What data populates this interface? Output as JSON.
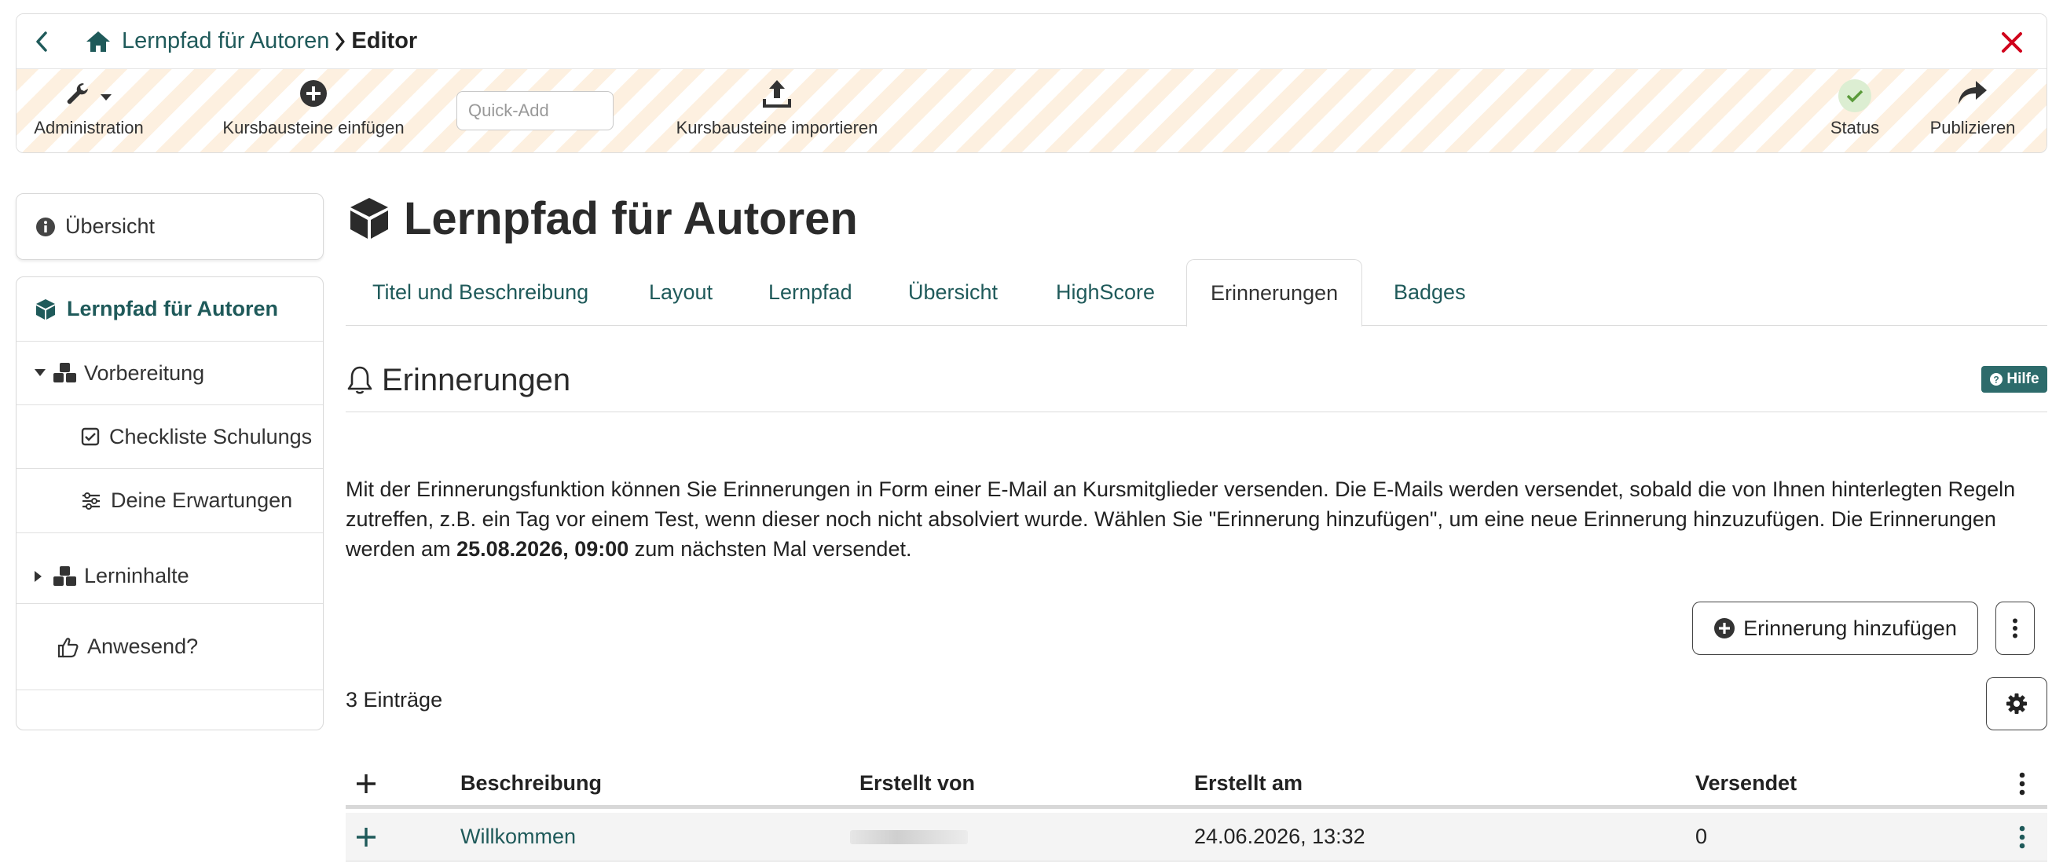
{
  "breadcrumb": {
    "course_link": "Lernpfad für Autoren",
    "current": "Editor"
  },
  "toolbar": {
    "administration": "Administration",
    "insert_nodes": "Kursbausteine einfügen",
    "quick_add_placeholder": "Quick-Add",
    "import_nodes": "Kursbausteine importieren",
    "status": "Status",
    "publish": "Publizieren"
  },
  "sidebar": {
    "overview": "Übersicht",
    "course_root": "Lernpfad für Autoren",
    "items": [
      {
        "label": "Vorbereitung"
      },
      {
        "label": "Checkliste Schulungs"
      },
      {
        "label": "Deine Erwartungen"
      },
      {
        "label": "Lerninhalte"
      },
      {
        "label": "Anwesend?"
      }
    ]
  },
  "page": {
    "title": "Lernpfad für Autoren"
  },
  "tabs": [
    {
      "label": "Titel und Beschreibung"
    },
    {
      "label": "Layout"
    },
    {
      "label": "Lernpfad"
    },
    {
      "label": "Übersicht"
    },
    {
      "label": "HighScore"
    },
    {
      "label": "Erinnerungen"
    },
    {
      "label": "Badges"
    }
  ],
  "reminders": {
    "section_title": "Erinnerungen",
    "help": "Hilfe",
    "desc_part1": "Mit der Erinnerungsfunktion können Sie Erinnerungen in Form einer E-Mail an Kursmitglieder versenden. Die E-Mails werden versendet, sobald die von Ihnen hinterlegten Regeln zutreffen, z.B. ein Tag vor einem Test, wenn dieser noch nicht absolviert wurde. Wählen Sie \"Erinnerung hinzufügen\", um eine neue Erinnerung hinzuzufügen. Die Erinnerungen werden am ",
    "desc_bold": "25.08.2026, 09:00",
    "desc_part2": " zum nächsten Mal versendet.",
    "add_button": "Erinnerung hinzufügen",
    "entries_count": "3 Einträge"
  },
  "table": {
    "columns": {
      "description": "Beschreibung",
      "created_by": "Erstellt von",
      "created_at": "Erstellt am",
      "sent": "Versendet"
    },
    "rows": [
      {
        "description": "Willkommen",
        "created_at": "24.06.2026, 13:32",
        "sent": "0"
      }
    ]
  },
  "colors": {
    "accent": "#1f5a5a",
    "help_badge": "#2d6b6b",
    "close": "#d0021b",
    "status_ok": "#5a9a3a"
  },
  "icons": {
    "back": "chevron-left-icon",
    "home": "home-icon",
    "close": "close-icon",
    "administration": "wrench-icon",
    "insert": "plus-circle-icon",
    "import": "upload-icon",
    "status": "check-icon",
    "publish": "share-arrow-icon"
  }
}
